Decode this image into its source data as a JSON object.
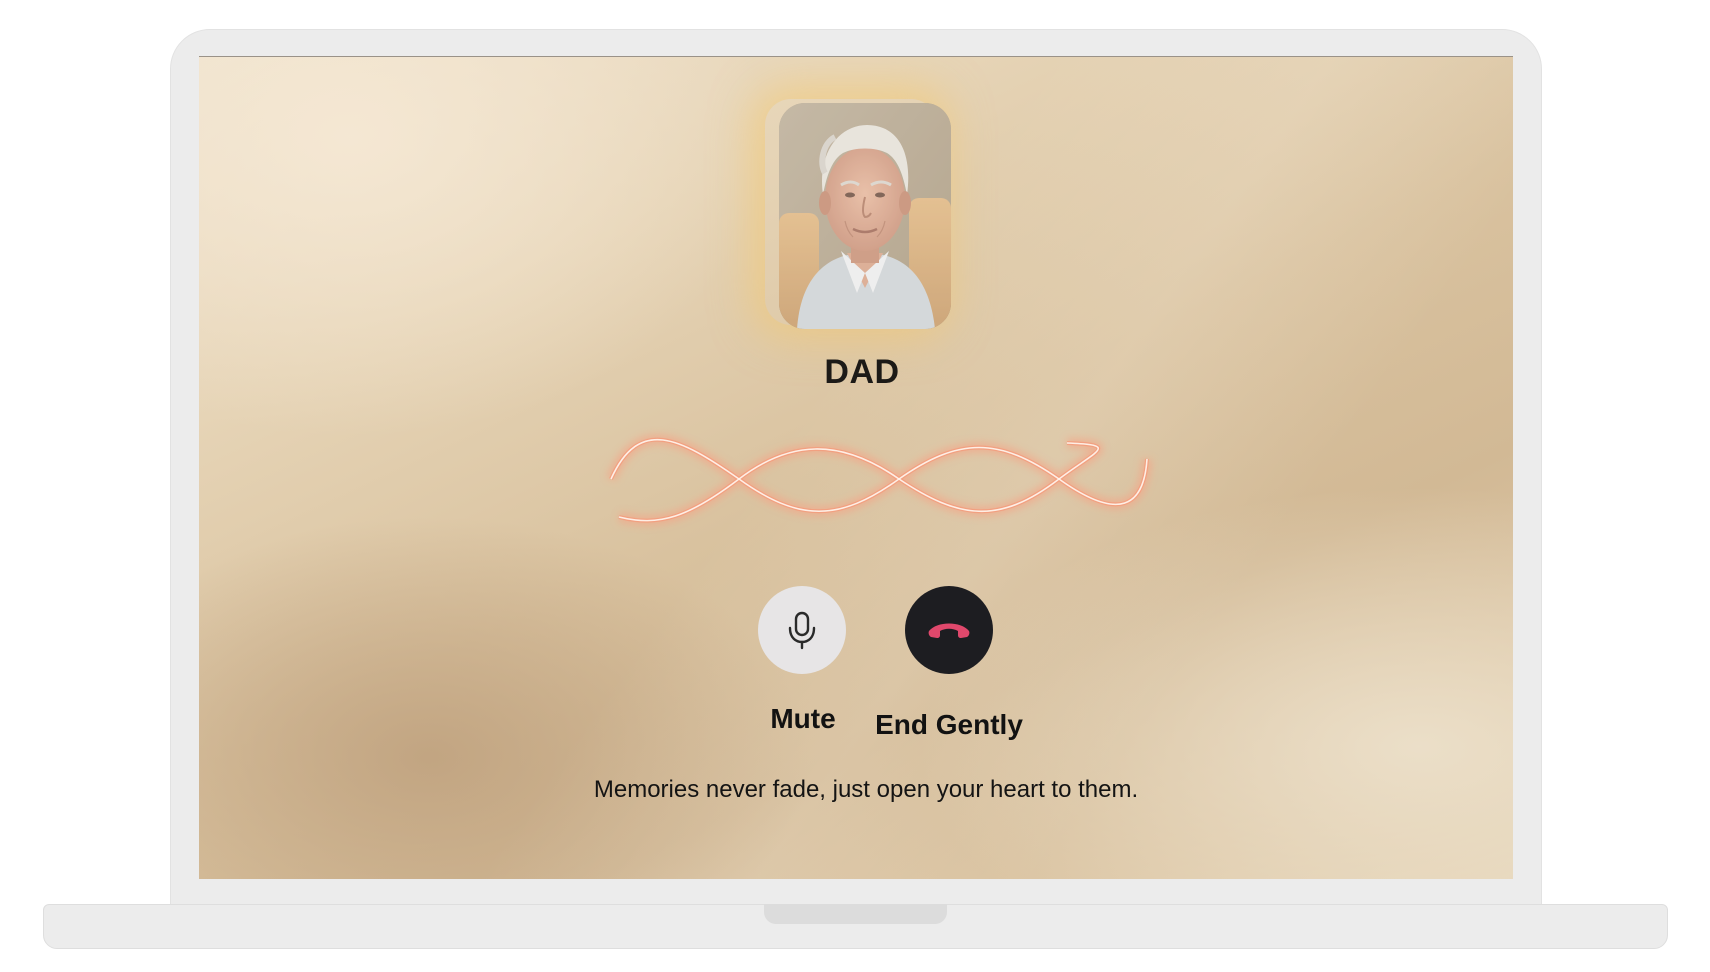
{
  "call": {
    "caller_name": "DAD",
    "avatar_alt": "portrait photo",
    "mute_label": "Mute",
    "end_label": "End Gently",
    "quote": "Memories never fade, just open your heart to them."
  },
  "icons": {
    "mute": "microphone-icon",
    "end": "phone-hangup-icon"
  },
  "colors": {
    "wave": "#f3a88a",
    "end_icon": "#e0486c",
    "end_button": "#1d1d21",
    "mute_button": "#e7e5e6",
    "avatar_glow": "#f4c86e"
  }
}
